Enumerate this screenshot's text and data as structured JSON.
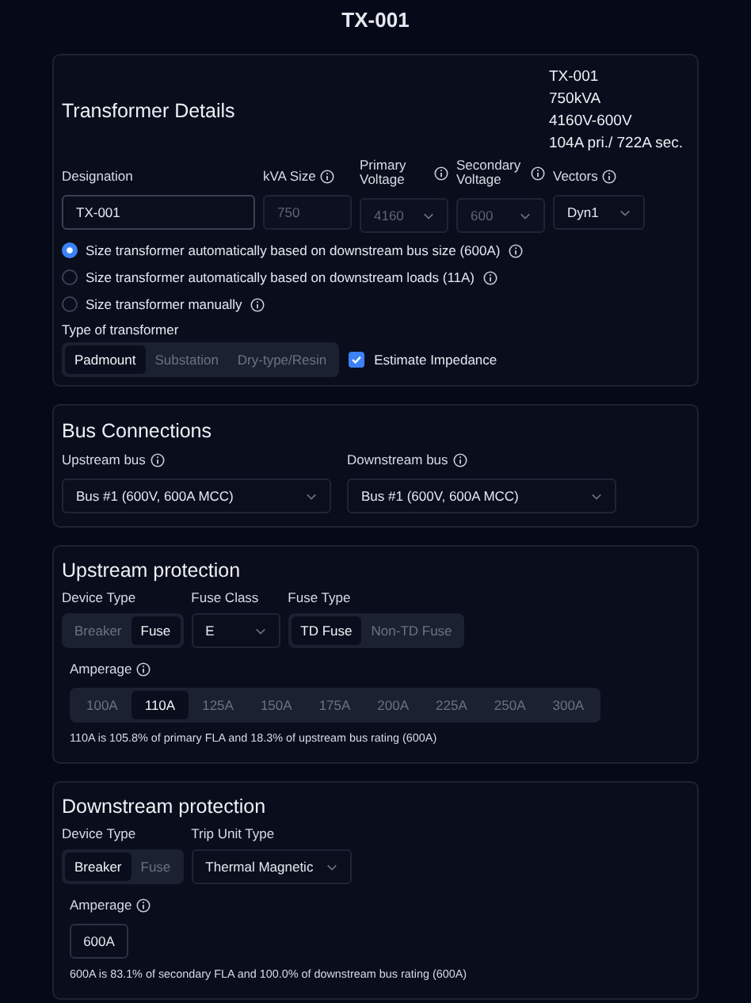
{
  "title": "TX-001",
  "transformer_details": {
    "heading": "Transformer Details",
    "summary": [
      "TX-001",
      "750kVA",
      "4160V-600V",
      "104A pri./ 722A sec."
    ],
    "fields": [
      {
        "label": "Designation",
        "kind": "text",
        "value": "TX-001",
        "disabled": false,
        "info": false
      },
      {
        "label": "kVA Size",
        "kind": "text",
        "value": "750",
        "disabled": true,
        "info": true
      },
      {
        "label": "Primary Voltage",
        "kind": "select",
        "value": "4160",
        "disabled": true,
        "info": true
      },
      {
        "label": "Secondary Voltage",
        "kind": "select",
        "value": "600",
        "disabled": true,
        "info": true
      },
      {
        "label": "Vectors",
        "kind": "select",
        "value": "Dyn1",
        "disabled": false,
        "info": true
      }
    ],
    "sizing_options": [
      {
        "label": "Size transformer automatically based on downstream bus size (600A)",
        "selected": true,
        "info": true
      },
      {
        "label": "Size transformer automatically based on downstream loads (11A)",
        "selected": false,
        "info": true
      },
      {
        "label": "Size transformer manually",
        "selected": false,
        "info": true
      }
    ],
    "type_label": "Type of transformer",
    "types": [
      {
        "label": "Padmount",
        "selected": true
      },
      {
        "label": "Substation",
        "selected": false
      },
      {
        "label": "Dry-type/Resin",
        "selected": false
      }
    ],
    "estimate_impedance": {
      "label": "Estimate Impedance",
      "checked": true
    }
  },
  "bus_connections": {
    "heading": "Bus Connections",
    "fields": [
      {
        "label": "Upstream bus",
        "value": "Bus #1 (600V, 600A MCC)",
        "info": true
      },
      {
        "label": "Downstream bus",
        "value": "Bus #1 (600V, 600A MCC)",
        "info": true
      }
    ]
  },
  "upstream_protection": {
    "heading": "Upstream protection",
    "controls": [
      {
        "kind": "segmented",
        "label": "Device Type",
        "options": [
          {
            "label": "Breaker",
            "selected": false
          },
          {
            "label": "Fuse",
            "selected": true
          }
        ]
      },
      {
        "kind": "select",
        "label": "Fuse Class",
        "value": "E"
      },
      {
        "kind": "segmented",
        "label": "Fuse Type",
        "options": [
          {
            "label": "TD Fuse",
            "selected": true
          },
          {
            "label": "Non-TD Fuse",
            "selected": false
          }
        ]
      }
    ],
    "amperage": {
      "label": "Amperage",
      "info": true,
      "kind": "segmented",
      "options": [
        {
          "label": "100A",
          "selected": false
        },
        {
          "label": "110A",
          "selected": true
        },
        {
          "label": "125A",
          "selected": false
        },
        {
          "label": "150A",
          "selected": false
        },
        {
          "label": "175A",
          "selected": false
        },
        {
          "label": "200A",
          "selected": false
        },
        {
          "label": "225A",
          "selected": false
        },
        {
          "label": "250A",
          "selected": false
        },
        {
          "label": "300A",
          "selected": false
        }
      ]
    },
    "note": "110A is 105.8% of primary FLA and 18.3% of upstream bus rating (600A)"
  },
  "downstream_protection": {
    "heading": "Downstream protection",
    "controls": [
      {
        "kind": "segmented",
        "label": "Device Type",
        "options": [
          {
            "label": "Breaker",
            "selected": true
          },
          {
            "label": "Fuse",
            "selected": false
          }
        ]
      },
      {
        "kind": "select",
        "label": "Trip Unit Type",
        "value": "Thermal Magnetic"
      }
    ],
    "amperage": {
      "label": "Amperage",
      "info": true,
      "kind": "value",
      "value": "600A"
    },
    "note": "600A is 83.1% of secondary FLA and 100.0% of downstream bus rating (600A)"
  }
}
